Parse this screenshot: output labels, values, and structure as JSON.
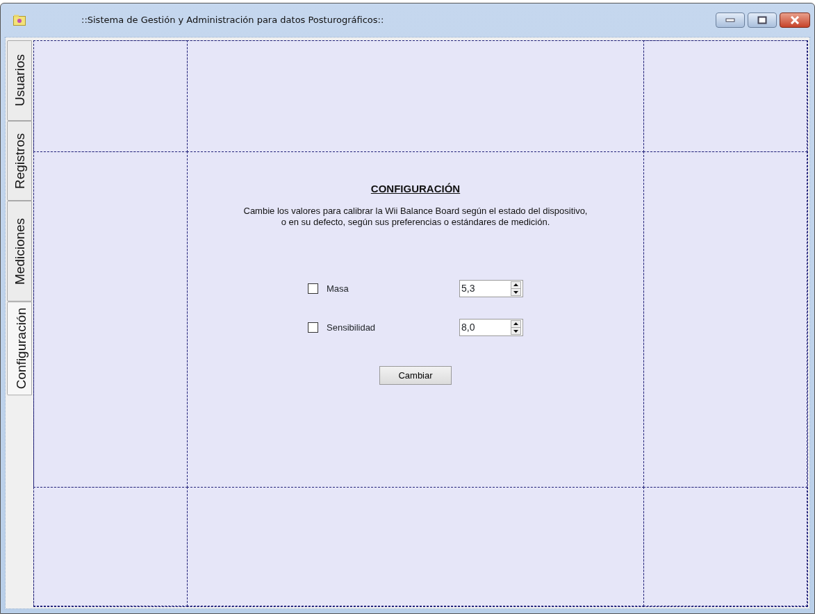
{
  "window": {
    "title": "::Sistema de Gestión y Administración para datos Posturográficos::"
  },
  "tabs": [
    {
      "label": "Usuarios",
      "selected": false
    },
    {
      "label": "Registros",
      "selected": false
    },
    {
      "label": "Mediciones",
      "selected": false
    },
    {
      "label": "Configuración",
      "selected": true
    }
  ],
  "config": {
    "heading": "CONFIGURACIÓN",
    "description": "Cambie los valores para calibrar la Wii Balance Board según el estado del dispositivo,\no en su defecto, según sus preferencias o estándares de medición.",
    "settings": [
      {
        "label": "Masa",
        "checked": false,
        "value": "5,3"
      },
      {
        "label": "Sensibilidad",
        "checked": false,
        "value": "8,0"
      }
    ],
    "button": "Cambiar"
  }
}
